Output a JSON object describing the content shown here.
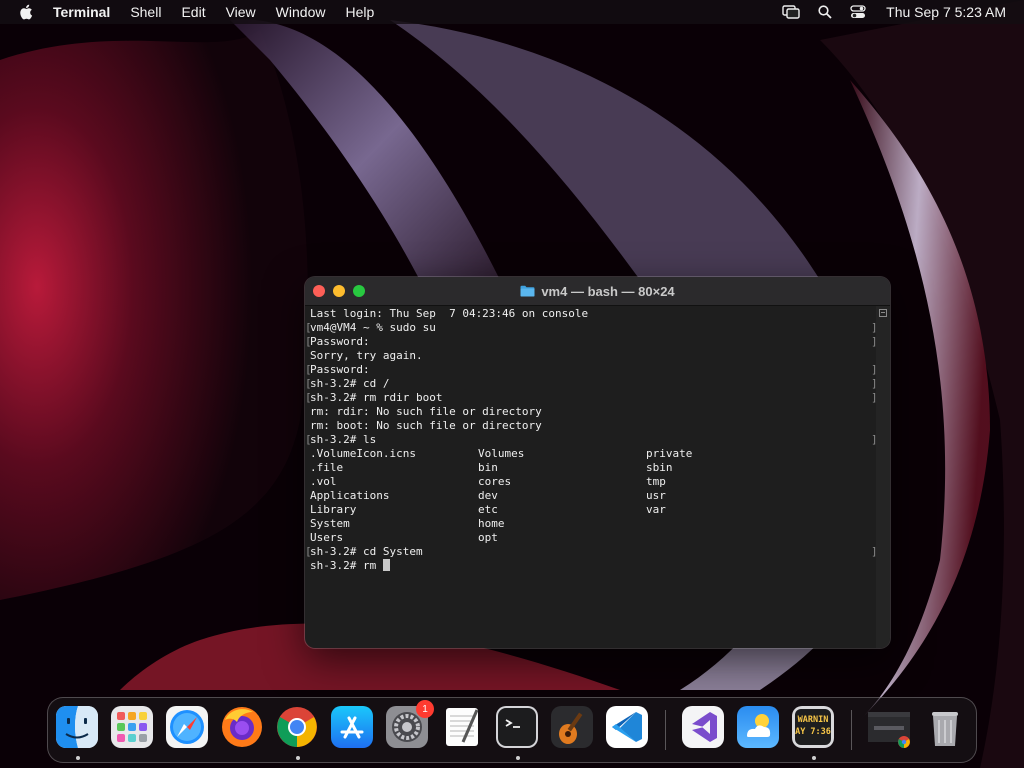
{
  "menubar": {
    "app_name": "Terminal",
    "menus": [
      "Shell",
      "Edit",
      "View",
      "Window",
      "Help"
    ],
    "clock": "Thu Sep 7  5:23 AM",
    "status_icons": [
      "window-mirroring-icon",
      "spotlight-search-icon",
      "control-center-icon"
    ]
  },
  "terminal": {
    "title": "vm4 — bash — 80×24",
    "lines": [
      {
        "text": "Last login: Thu Sep  7 04:23:46 on console",
        "marker": false
      },
      {
        "text": "vm4@VM4 ~ % sudo su",
        "marker": true
      },
      {
        "text": "Password:",
        "marker": true
      },
      {
        "text": "Sorry, try again.",
        "marker": false
      },
      {
        "text": "Password:",
        "marker": true
      },
      {
        "text": "sh-3.2# cd /",
        "marker": true
      },
      {
        "text": "sh-3.2# rm rdir boot",
        "marker": true
      },
      {
        "text": "rm: rdir: No such file or directory",
        "marker": false
      },
      {
        "text": "rm: boot: No such file or directory",
        "marker": false
      },
      {
        "text": "sh-3.2# ls",
        "marker": true
      }
    ],
    "listing": [
      [
        ".VolumeIcon.icns",
        "Volumes",
        "private"
      ],
      [
        ".file",
        "bin",
        "sbin"
      ],
      [
        ".vol",
        "cores",
        "tmp"
      ],
      [
        "Applications",
        "dev",
        "usr"
      ],
      [
        "Library",
        "etc",
        "var"
      ],
      [
        "System",
        "home",
        ""
      ],
      [
        "Users",
        "opt",
        ""
      ]
    ],
    "after_lines": [
      {
        "text": "sh-3.2# cd System",
        "marker": true
      }
    ],
    "prompt": "sh-3.2# rm "
  },
  "dock": {
    "items": [
      {
        "name": "finder",
        "running": true
      },
      {
        "name": "launchpad",
        "running": false
      },
      {
        "name": "safari",
        "running": false
      },
      {
        "name": "firefox",
        "running": false
      },
      {
        "name": "chrome",
        "running": true
      },
      {
        "name": "app-store",
        "running": false
      },
      {
        "name": "system-settings",
        "running": false,
        "badge": "1"
      },
      {
        "name": "textedit",
        "running": false
      },
      {
        "name": "terminal",
        "running": true
      },
      {
        "name": "garageband",
        "running": false
      },
      {
        "name": "vscode",
        "running": false
      },
      {
        "name": "visual-studio",
        "running": false
      },
      {
        "name": "weather",
        "running": false
      },
      {
        "name": "console",
        "running": true,
        "label_line1": "WARNIN",
        "label_line2": "AY 7:36"
      },
      {
        "name": "chrome-window",
        "running": false
      },
      {
        "name": "trash",
        "running": false
      }
    ]
  }
}
